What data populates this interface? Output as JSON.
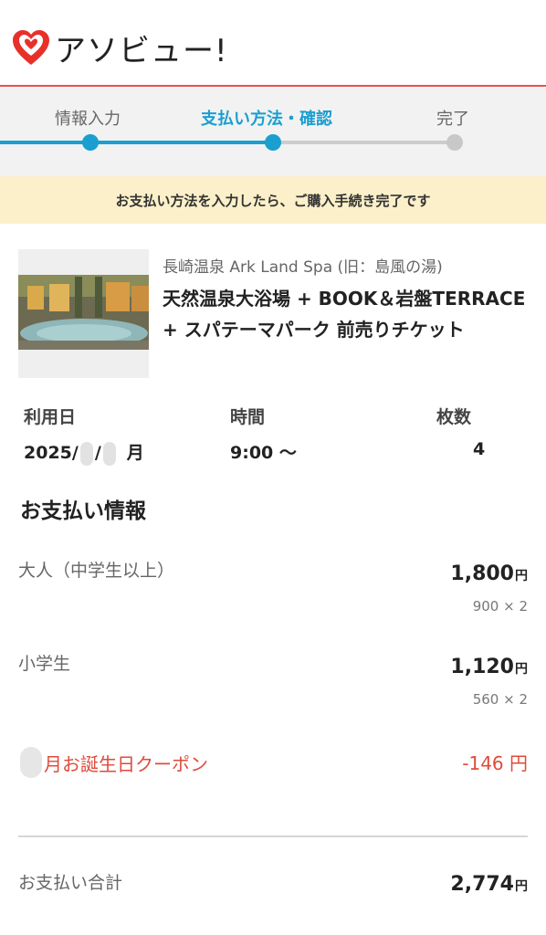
{
  "brand": {
    "name": "アソビュー!",
    "logo_color": "#e8302b"
  },
  "progress": {
    "steps": [
      {
        "label": "情報入力",
        "state": "done"
      },
      {
        "label": "支払い方法・確認",
        "state": "current"
      },
      {
        "label": "完了",
        "state": "todo"
      }
    ],
    "active_color": "#1a9fd0"
  },
  "notice": "お支払い方法を入力したら、ご購入手続き完了です",
  "product": {
    "venue": "長崎温泉 Ark Land Spa (旧：島風の湯)",
    "title": "天然温泉大浴場 + BOOK＆岩盤TERRACE + スパテーマパーク 前売りチケット"
  },
  "usage": {
    "date_label": "利用日",
    "date_prefix": "2025/",
    "date_mid": "/",
    "date_suffix": "月",
    "time_label": "時間",
    "time_value": "9:00 〜",
    "count_label": "枚数",
    "count_value": "4"
  },
  "payment": {
    "section_title": "お支払い情報",
    "lines": [
      {
        "label": "大人（中学生以上）",
        "amount": "1,800",
        "unit": "円",
        "detail": "900 × 2"
      },
      {
        "label": "小学生",
        "amount": "1,120",
        "unit": "円",
        "detail": "560 × 2"
      }
    ],
    "coupon": {
      "label": "月お誕生日クーポン",
      "amount": "-146 円",
      "color": "#e04a3a"
    },
    "total": {
      "label": "お支払い合計",
      "amount": "2,774",
      "unit": "円"
    }
  }
}
